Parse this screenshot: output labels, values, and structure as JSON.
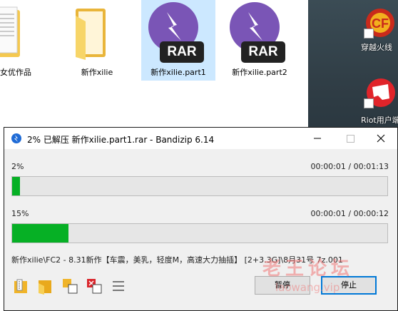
{
  "explorer": {
    "files": [
      {
        "name": "女优作品",
        "type": "folder-doc",
        "selected": false
      },
      {
        "name": "新作xilie",
        "type": "folder",
        "selected": false
      },
      {
        "name": "新作xilie.part1",
        "type": "rar",
        "selected": true
      },
      {
        "name": "新作xilie.part2",
        "type": "rar",
        "selected": false
      }
    ],
    "rar_tag": "RAR"
  },
  "desktop": {
    "icons": [
      {
        "label": "穿越火线",
        "icon": "crossfire-icon"
      },
      {
        "label": "Riot用户端",
        "icon": "riot-client-icon"
      }
    ]
  },
  "window": {
    "title": "2% 已解压 新作xilie.part1.rar - Bandizip 6.14",
    "file_progress": {
      "percent_label": "2%",
      "time": "00:00:01 / 00:01:13",
      "fraction": 0.02
    },
    "total_progress": {
      "percent_label": "15%",
      "time": "00:00:01 / 00:00:12",
      "fraction": 0.15
    },
    "current_path": "新作xilie\\FC2 - 8.31新作【车震，美乳，轻度M，高速大力抽插】 [2+3.3G]\\8月31号 7z.001",
    "buttons": {
      "pause": "暂停",
      "stop": "停止"
    }
  },
  "watermark": {
    "line1": "老王论坛",
    "line2": "laowang.vip"
  },
  "colors": {
    "progress": "#06b025",
    "rar_purple": "#7a55b6",
    "selection": "#cce8ff"
  }
}
